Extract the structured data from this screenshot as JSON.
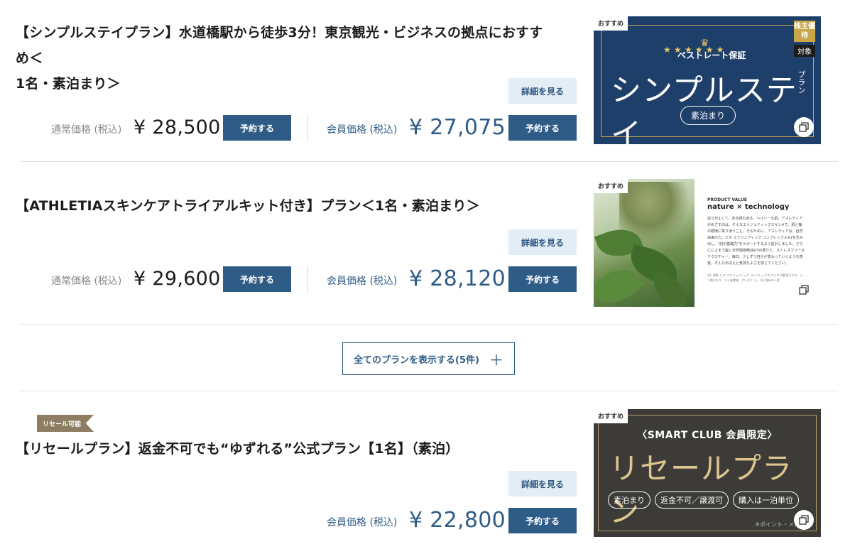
{
  "common": {
    "detail_label": "詳細を見る",
    "reserve_label": "予約する",
    "regular_price_label": "通常価格 (税込)",
    "member_price_label": "会員価格 (税込)",
    "recommend_badge": "おすすめ"
  },
  "plans": [
    {
      "title_line1": "【シンプルステイプラン】水道橋駅から徒歩3分！東京観光・ビジネスの拠点におすすめ＜",
      "title_line2": "1名・素泊まり＞",
      "regular_price": "¥ 28,500",
      "member_price": "¥ 27,075",
      "image": {
        "best_rate": "ベストレート保証",
        "stars": "★ ★ ★    ★ ★ ★",
        "crown": "♛",
        "main_text": "シンプルステイ",
        "plan_vertical": "プラン",
        "pill": "素泊まり",
        "kabu": "株主優待",
        "taisho": "対象"
      }
    },
    {
      "title_line1": "【ATHLETIAスキンケアトライアルキット付き】プラン＜1名・素泊まり＞",
      "regular_price": "¥ 29,600",
      "member_price": "¥ 28,120",
      "image": {
        "product_value": "PRODUCT VALUE",
        "headline": "nature × technology",
        "body": "巡りがよくて、本也感のある、ヘルシーな肌。アスレティアがめざすのは、そんなエナジェティックスキン※で。肌と静の循環に寄り添うこと。そのために、アスレティアは、自然由来の力、ビオ エナジェティック コンプレックス※2を生み出し、\"肌の基礎力\"をサポートするよう設計しました。さらにによまで届く天然植物精油※3の香りと、ストレスフリーなテクスチャー。毎日、少しずつ自分が変わっていくような感覚。そんな手応えと気持ちよさを感じてください。",
        "footnote": "※1【株】ビオ エナジェティック コンプレックス(アシタバ葉/茎エキス、シソ葉エキス、コメ発酵液、グリセリン)。 ※2 香料の一部"
      }
    },
    {
      "resale_tag": "リセール可能",
      "title_line1": "【リセールプラン】返金不可でも“ゆずれる”公式プラン【1名】（素泊）",
      "member_price": "¥ 22,800",
      "image": {
        "header": "〈SMART CLUB 会員限定〉",
        "main_text": "リセールプラン",
        "pills": [
          "素泊まり",
          "返金不可／譲渡可",
          "購入は一泊単位"
        ],
        "note": "※ポイント・メダルは"
      }
    }
  ],
  "show_all_label": "全てのプランを表示する(5件)",
  "show_all_icon": "plus-icon"
}
